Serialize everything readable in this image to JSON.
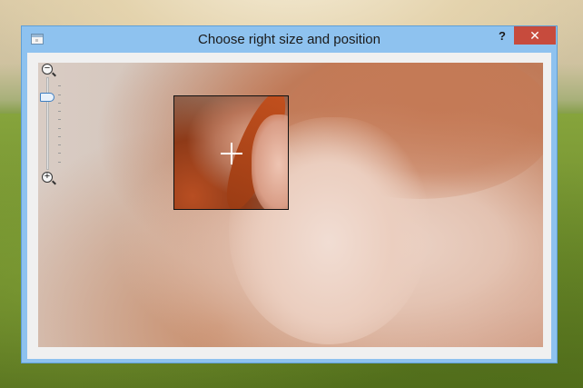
{
  "window": {
    "title": "Choose right size and position",
    "help_label": "?",
    "close_label": "✕",
    "icons": {
      "system_menu": "app-icon",
      "zoom_out": "zoom-out-icon",
      "zoom_in": "zoom-in-icon",
      "crosshair": "crosshair-icon"
    }
  },
  "zoom": {
    "out_symbol": "−",
    "in_symbol": "+",
    "level": 0.22
  },
  "colors": {
    "window_frame": "#8ec2ef",
    "close_button": "#c74b3d"
  }
}
